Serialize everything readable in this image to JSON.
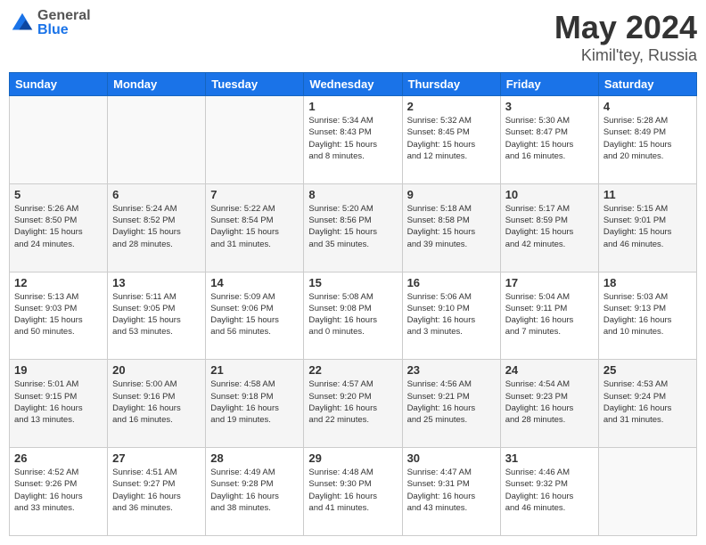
{
  "header": {
    "logo_general": "General",
    "logo_blue": "Blue",
    "title": "May 2024",
    "subtitle": "Kimil'tey, Russia"
  },
  "weekdays": [
    "Sunday",
    "Monday",
    "Tuesday",
    "Wednesday",
    "Thursday",
    "Friday",
    "Saturday"
  ],
  "weeks": [
    [
      {
        "day": "",
        "info": ""
      },
      {
        "day": "",
        "info": ""
      },
      {
        "day": "",
        "info": ""
      },
      {
        "day": "1",
        "info": "Sunrise: 5:34 AM\nSunset: 8:43 PM\nDaylight: 15 hours\nand 8 minutes."
      },
      {
        "day": "2",
        "info": "Sunrise: 5:32 AM\nSunset: 8:45 PM\nDaylight: 15 hours\nand 12 minutes."
      },
      {
        "day": "3",
        "info": "Sunrise: 5:30 AM\nSunset: 8:47 PM\nDaylight: 15 hours\nand 16 minutes."
      },
      {
        "day": "4",
        "info": "Sunrise: 5:28 AM\nSunset: 8:49 PM\nDaylight: 15 hours\nand 20 minutes."
      }
    ],
    [
      {
        "day": "5",
        "info": "Sunrise: 5:26 AM\nSunset: 8:50 PM\nDaylight: 15 hours\nand 24 minutes."
      },
      {
        "day": "6",
        "info": "Sunrise: 5:24 AM\nSunset: 8:52 PM\nDaylight: 15 hours\nand 28 minutes."
      },
      {
        "day": "7",
        "info": "Sunrise: 5:22 AM\nSunset: 8:54 PM\nDaylight: 15 hours\nand 31 minutes."
      },
      {
        "day": "8",
        "info": "Sunrise: 5:20 AM\nSunset: 8:56 PM\nDaylight: 15 hours\nand 35 minutes."
      },
      {
        "day": "9",
        "info": "Sunrise: 5:18 AM\nSunset: 8:58 PM\nDaylight: 15 hours\nand 39 minutes."
      },
      {
        "day": "10",
        "info": "Sunrise: 5:17 AM\nSunset: 8:59 PM\nDaylight: 15 hours\nand 42 minutes."
      },
      {
        "day": "11",
        "info": "Sunrise: 5:15 AM\nSunset: 9:01 PM\nDaylight: 15 hours\nand 46 minutes."
      }
    ],
    [
      {
        "day": "12",
        "info": "Sunrise: 5:13 AM\nSunset: 9:03 PM\nDaylight: 15 hours\nand 50 minutes."
      },
      {
        "day": "13",
        "info": "Sunrise: 5:11 AM\nSunset: 9:05 PM\nDaylight: 15 hours\nand 53 minutes."
      },
      {
        "day": "14",
        "info": "Sunrise: 5:09 AM\nSunset: 9:06 PM\nDaylight: 15 hours\nand 56 minutes."
      },
      {
        "day": "15",
        "info": "Sunrise: 5:08 AM\nSunset: 9:08 PM\nDaylight: 16 hours\nand 0 minutes."
      },
      {
        "day": "16",
        "info": "Sunrise: 5:06 AM\nSunset: 9:10 PM\nDaylight: 16 hours\nand 3 minutes."
      },
      {
        "day": "17",
        "info": "Sunrise: 5:04 AM\nSunset: 9:11 PM\nDaylight: 16 hours\nand 7 minutes."
      },
      {
        "day": "18",
        "info": "Sunrise: 5:03 AM\nSunset: 9:13 PM\nDaylight: 16 hours\nand 10 minutes."
      }
    ],
    [
      {
        "day": "19",
        "info": "Sunrise: 5:01 AM\nSunset: 9:15 PM\nDaylight: 16 hours\nand 13 minutes."
      },
      {
        "day": "20",
        "info": "Sunrise: 5:00 AM\nSunset: 9:16 PM\nDaylight: 16 hours\nand 16 minutes."
      },
      {
        "day": "21",
        "info": "Sunrise: 4:58 AM\nSunset: 9:18 PM\nDaylight: 16 hours\nand 19 minutes."
      },
      {
        "day": "22",
        "info": "Sunrise: 4:57 AM\nSunset: 9:20 PM\nDaylight: 16 hours\nand 22 minutes."
      },
      {
        "day": "23",
        "info": "Sunrise: 4:56 AM\nSunset: 9:21 PM\nDaylight: 16 hours\nand 25 minutes."
      },
      {
        "day": "24",
        "info": "Sunrise: 4:54 AM\nSunset: 9:23 PM\nDaylight: 16 hours\nand 28 minutes."
      },
      {
        "day": "25",
        "info": "Sunrise: 4:53 AM\nSunset: 9:24 PM\nDaylight: 16 hours\nand 31 minutes."
      }
    ],
    [
      {
        "day": "26",
        "info": "Sunrise: 4:52 AM\nSunset: 9:26 PM\nDaylight: 16 hours\nand 33 minutes."
      },
      {
        "day": "27",
        "info": "Sunrise: 4:51 AM\nSunset: 9:27 PM\nDaylight: 16 hours\nand 36 minutes."
      },
      {
        "day": "28",
        "info": "Sunrise: 4:49 AM\nSunset: 9:28 PM\nDaylight: 16 hours\nand 38 minutes."
      },
      {
        "day": "29",
        "info": "Sunrise: 4:48 AM\nSunset: 9:30 PM\nDaylight: 16 hours\nand 41 minutes."
      },
      {
        "day": "30",
        "info": "Sunrise: 4:47 AM\nSunset: 9:31 PM\nDaylight: 16 hours\nand 43 minutes."
      },
      {
        "day": "31",
        "info": "Sunrise: 4:46 AM\nSunset: 9:32 PM\nDaylight: 16 hours\nand 46 minutes."
      },
      {
        "day": "",
        "info": ""
      }
    ]
  ]
}
